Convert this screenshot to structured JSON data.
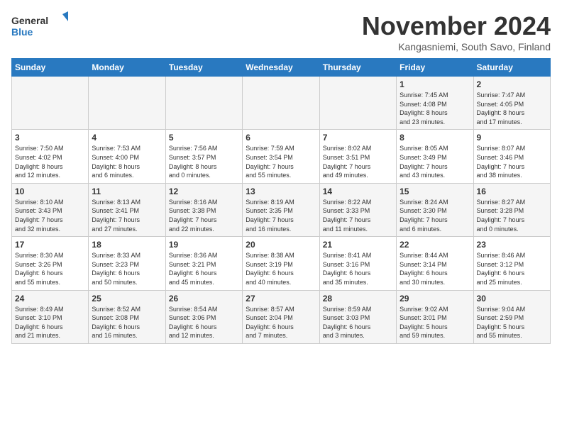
{
  "logo": {
    "line1": "General",
    "line2": "Blue"
  },
  "title": "November 2024",
  "subtitle": "Kangasniemi, South Savo, Finland",
  "weekdays": [
    "Sunday",
    "Monday",
    "Tuesday",
    "Wednesday",
    "Thursday",
    "Friday",
    "Saturday"
  ],
  "weeks": [
    [
      {
        "day": "",
        "info": ""
      },
      {
        "day": "",
        "info": ""
      },
      {
        "day": "",
        "info": ""
      },
      {
        "day": "",
        "info": ""
      },
      {
        "day": "",
        "info": ""
      },
      {
        "day": "1",
        "info": "Sunrise: 7:45 AM\nSunset: 4:08 PM\nDaylight: 8 hours\nand 23 minutes."
      },
      {
        "day": "2",
        "info": "Sunrise: 7:47 AM\nSunset: 4:05 PM\nDaylight: 8 hours\nand 17 minutes."
      }
    ],
    [
      {
        "day": "3",
        "info": "Sunrise: 7:50 AM\nSunset: 4:02 PM\nDaylight: 8 hours\nand 12 minutes."
      },
      {
        "day": "4",
        "info": "Sunrise: 7:53 AM\nSunset: 4:00 PM\nDaylight: 8 hours\nand 6 minutes."
      },
      {
        "day": "5",
        "info": "Sunrise: 7:56 AM\nSunset: 3:57 PM\nDaylight: 8 hours\nand 0 minutes."
      },
      {
        "day": "6",
        "info": "Sunrise: 7:59 AM\nSunset: 3:54 PM\nDaylight: 7 hours\nand 55 minutes."
      },
      {
        "day": "7",
        "info": "Sunrise: 8:02 AM\nSunset: 3:51 PM\nDaylight: 7 hours\nand 49 minutes."
      },
      {
        "day": "8",
        "info": "Sunrise: 8:05 AM\nSunset: 3:49 PM\nDaylight: 7 hours\nand 43 minutes."
      },
      {
        "day": "9",
        "info": "Sunrise: 8:07 AM\nSunset: 3:46 PM\nDaylight: 7 hours\nand 38 minutes."
      }
    ],
    [
      {
        "day": "10",
        "info": "Sunrise: 8:10 AM\nSunset: 3:43 PM\nDaylight: 7 hours\nand 32 minutes."
      },
      {
        "day": "11",
        "info": "Sunrise: 8:13 AM\nSunset: 3:41 PM\nDaylight: 7 hours\nand 27 minutes."
      },
      {
        "day": "12",
        "info": "Sunrise: 8:16 AM\nSunset: 3:38 PM\nDaylight: 7 hours\nand 22 minutes."
      },
      {
        "day": "13",
        "info": "Sunrise: 8:19 AM\nSunset: 3:35 PM\nDaylight: 7 hours\nand 16 minutes."
      },
      {
        "day": "14",
        "info": "Sunrise: 8:22 AM\nSunset: 3:33 PM\nDaylight: 7 hours\nand 11 minutes."
      },
      {
        "day": "15",
        "info": "Sunrise: 8:24 AM\nSunset: 3:30 PM\nDaylight: 7 hours\nand 6 minutes."
      },
      {
        "day": "16",
        "info": "Sunrise: 8:27 AM\nSunset: 3:28 PM\nDaylight: 7 hours\nand 0 minutes."
      }
    ],
    [
      {
        "day": "17",
        "info": "Sunrise: 8:30 AM\nSunset: 3:26 PM\nDaylight: 6 hours\nand 55 minutes."
      },
      {
        "day": "18",
        "info": "Sunrise: 8:33 AM\nSunset: 3:23 PM\nDaylight: 6 hours\nand 50 minutes."
      },
      {
        "day": "19",
        "info": "Sunrise: 8:36 AM\nSunset: 3:21 PM\nDaylight: 6 hours\nand 45 minutes."
      },
      {
        "day": "20",
        "info": "Sunrise: 8:38 AM\nSunset: 3:19 PM\nDaylight: 6 hours\nand 40 minutes."
      },
      {
        "day": "21",
        "info": "Sunrise: 8:41 AM\nSunset: 3:16 PM\nDaylight: 6 hours\nand 35 minutes."
      },
      {
        "day": "22",
        "info": "Sunrise: 8:44 AM\nSunset: 3:14 PM\nDaylight: 6 hours\nand 30 minutes."
      },
      {
        "day": "23",
        "info": "Sunrise: 8:46 AM\nSunset: 3:12 PM\nDaylight: 6 hours\nand 25 minutes."
      }
    ],
    [
      {
        "day": "24",
        "info": "Sunrise: 8:49 AM\nSunset: 3:10 PM\nDaylight: 6 hours\nand 21 minutes."
      },
      {
        "day": "25",
        "info": "Sunrise: 8:52 AM\nSunset: 3:08 PM\nDaylight: 6 hours\nand 16 minutes."
      },
      {
        "day": "26",
        "info": "Sunrise: 8:54 AM\nSunset: 3:06 PM\nDaylight: 6 hours\nand 12 minutes."
      },
      {
        "day": "27",
        "info": "Sunrise: 8:57 AM\nSunset: 3:04 PM\nDaylight: 6 hours\nand 7 minutes."
      },
      {
        "day": "28",
        "info": "Sunrise: 8:59 AM\nSunset: 3:03 PM\nDaylight: 6 hours\nand 3 minutes."
      },
      {
        "day": "29",
        "info": "Sunrise: 9:02 AM\nSunset: 3:01 PM\nDaylight: 5 hours\nand 59 minutes."
      },
      {
        "day": "30",
        "info": "Sunrise: 9:04 AM\nSunset: 2:59 PM\nDaylight: 5 hours\nand 55 minutes."
      }
    ]
  ]
}
